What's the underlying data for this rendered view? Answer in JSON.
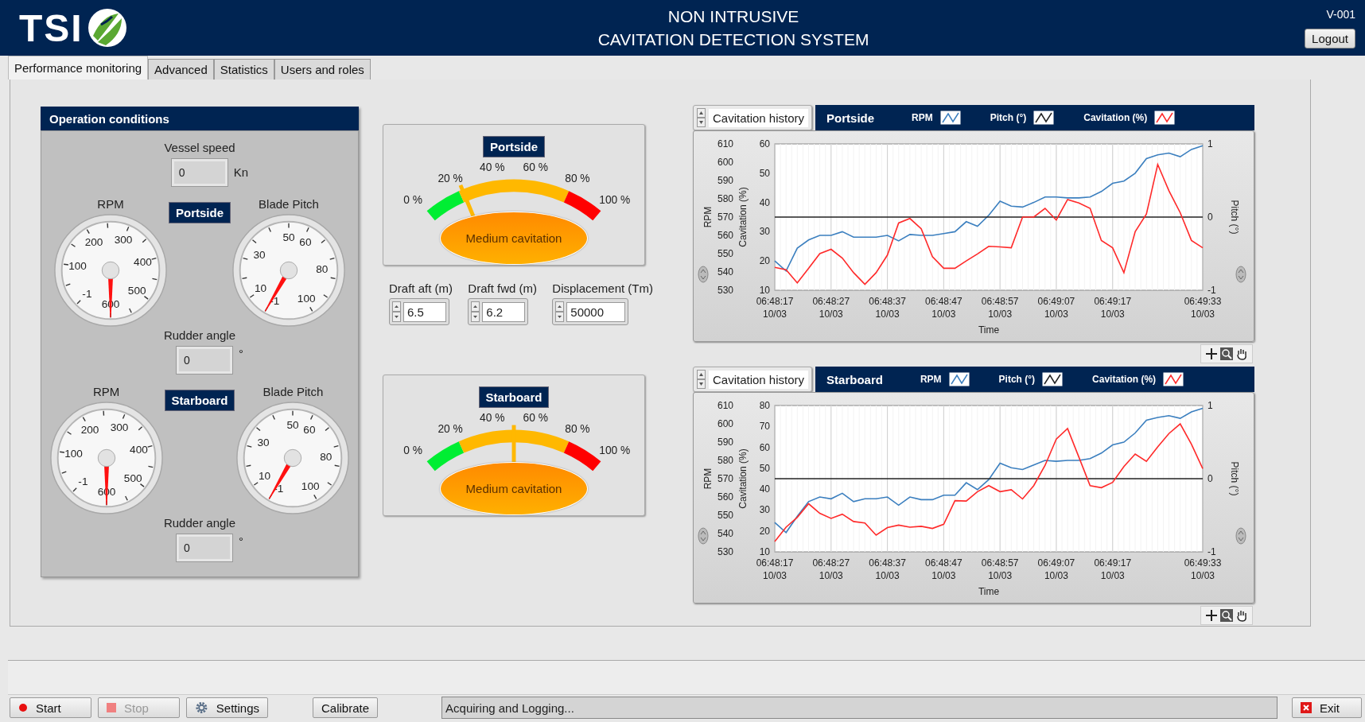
{
  "header": {
    "logo_text": "TSI",
    "title_lines": [
      "NON INTRUSIVE",
      "CAVITATION DETECTION SYSTEM"
    ],
    "version": "V-001",
    "logout": "Logout"
  },
  "tabs": [
    {
      "label": "Performance monitoring",
      "selected": true
    },
    {
      "label": "Advanced",
      "selected": false
    },
    {
      "label": "Statistics",
      "selected": false
    },
    {
      "label": "Users and roles",
      "selected": false
    }
  ],
  "operation_conditions": {
    "title": "Operation conditions",
    "vessel_speed": {
      "label": "Vessel speed",
      "value": "0",
      "unit": "Kn"
    },
    "sides": [
      {
        "tag": "Portside",
        "dials": [
          {
            "kind": "rpm",
            "label": "RPM",
            "scale": [
              "-1",
              "100",
              "200",
              "300",
              "400",
              "500",
              "600"
            ]
          },
          {
            "kind": "pitch",
            "label": "Blade Pitch",
            "scale": [
              "-1",
              "10",
              "30",
              "50",
              "60",
              "80",
              "100"
            ]
          }
        ],
        "rudder": {
          "label": "Rudder angle",
          "value": "0",
          "unit": "°"
        }
      },
      {
        "tag": "Starboard",
        "dials": [
          {
            "kind": "rpm",
            "label": "RPM",
            "scale": [
              "-1",
              "100",
              "200",
              "300",
              "400",
              "500",
              "600"
            ]
          },
          {
            "kind": "pitch",
            "label": "Blade Pitch",
            "scale": [
              "-1",
              "10",
              "30",
              "50",
              "60",
              "80",
              "100"
            ]
          }
        ],
        "rudder": {
          "label": "Rudder angle",
          "value": "0",
          "unit": "°"
        }
      }
    ]
  },
  "meters": [
    {
      "tag": "Portside",
      "scale": [
        "0 %",
        "20 %",
        "40 %",
        "60 %",
        "80 %",
        "100 %"
      ],
      "status": "Medium cavitation"
    },
    {
      "tag": "Starboard",
      "scale": [
        "0 %",
        "20 %",
        "40 %",
        "60 %",
        "80 %",
        "100 %"
      ],
      "status": "Medium cavitation"
    }
  ],
  "draft_fields": [
    {
      "label": "Draft aft (m)",
      "value": "6.5"
    },
    {
      "label": "Draft fwd (m)",
      "value": "6.2"
    },
    {
      "label": "Displacement (Tm)",
      "value": "50000"
    }
  ],
  "charts": [
    {
      "selector": "Cavitation history",
      "layers": [
        {
          "chart_data": {
            "type": "line",
            "title": "Portside",
            "grid": true,
            "xlabel": "Time",
            "ylabel": "RPM",
            "ylim": [
              530,
              610
            ],
            "yticks": [
              530,
              540,
              550,
              560,
              570,
              580,
              590,
              600,
              610
            ],
            "categories": [
              "06:48:17\n10/03",
              null,
              null,
              null,
              null,
              "06:48:27\n10/03",
              null,
              null,
              null,
              null,
              "06:48:37\n10/03",
              null,
              null,
              null,
              null,
              "06:48:47\n10/03",
              null,
              null,
              null,
              null,
              "06:48:57\n10/03",
              null,
              null,
              null,
              null,
              "06:49:07\n10/03",
              null,
              null,
              null,
              null,
              "06:49:17\n10/03",
              null,
              null,
              null,
              null,
              null,
              null,
              null,
              "06:49:33\n10/03"
            ],
            "series": [
              {
                "name": "RPM",
                "color": "#3b7fbf",
                "values": [
                  546,
                  540.5,
                  553,
                  557.5,
                  560,
                  560,
                  562,
                  559,
                  559,
                  559,
                  560,
                  557,
                  560.5,
                  560,
                  560,
                  561,
                  562,
                  567.5,
                  565,
                  571,
                  578.7,
                  576,
                  575.5,
                  578,
                  581,
                  581,
                  580.5,
                  580.5,
                  581,
                  584,
                  588.5,
                  589.7,
                  594,
                  602,
                  604,
                  605,
                  603,
                  607,
                  609
                ]
              }
            ]
          }
        },
        {
          "chart_data": {
            "type": "line",
            "ylabel": "Pitch (°)",
            "ylim": [
              -1,
              1
            ],
            "yticks": [
              -1,
              0,
              1
            ],
            "series": [
              {
                "name": "Pitch (°)",
                "color": "#222222",
                "values": [
                  0,
                  0,
                  0,
                  0,
                  0,
                  0,
                  0,
                  0,
                  0,
                  0,
                  0,
                  0,
                  0,
                  0,
                  0,
                  0,
                  0,
                  0,
                  0,
                  0,
                  0,
                  0,
                  0,
                  0,
                  0,
                  0,
                  0,
                  0,
                  0,
                  0,
                  0,
                  0,
                  0,
                  0,
                  0,
                  0,
                  0,
                  0,
                  0
                ]
              }
            ]
          }
        },
        {
          "chart_data": {
            "type": "line",
            "ylabel": "Cavitation (%)",
            "ylim": [
              10,
              60
            ],
            "yticks": [
              10,
              20,
              30,
              40,
              50,
              60
            ],
            "series": [
              {
                "name": "Cavitation (%)",
                "color": "#ff2a2a",
                "values": [
                  17.8,
                  17,
                  12.5,
                  17.5,
                  22.5,
                  24,
                  21,
                  16,
                  12,
                  16,
                  22,
                  33,
                  34.5,
                  31,
                  21.5,
                  17.5,
                  17.5,
                  20,
                  22.4,
                  25,
                  24.8,
                  24.5,
                  35,
                  35,
                  38,
                  34,
                  41,
                  39.8,
                  38,
                  27,
                  24.5,
                  16,
                  30,
                  36,
                  53,
                  44,
                  36.5,
                  27,
                  24.5
                ]
              }
            ]
          }
        }
      ]
    },
    {
      "selector": "Cavitation history",
      "layers": [
        {
          "chart_data": {
            "type": "line",
            "title": "Starboard",
            "grid": true,
            "xlabel": "Time",
            "ylabel": "RPM",
            "ylim": [
              530,
              610
            ],
            "yticks": [
              530,
              540,
              550,
              560,
              570,
              580,
              590,
              600,
              610
            ],
            "categories": [
              "06:48:17\n10/03",
              null,
              null,
              null,
              null,
              "06:48:27\n10/03",
              null,
              null,
              null,
              null,
              "06:48:37\n10/03",
              null,
              null,
              null,
              null,
              "06:48:47\n10/03",
              null,
              null,
              null,
              null,
              "06:48:57\n10/03",
              null,
              null,
              null,
              null,
              "06:49:07\n10/03",
              null,
              null,
              null,
              null,
              "06:49:17\n10/03",
              null,
              null,
              null,
              null,
              null,
              null,
              null,
              "06:49:33\n10/03"
            ],
            "series": [
              {
                "name": "RPM",
                "color": "#3b7fbf",
                "values": [
                  546,
                  540.5,
                  549.5,
                  557.5,
                  560,
                  559,
                  562,
                  557.5,
                  559,
                  559,
                  560,
                  555.5,
                  560,
                  558.5,
                  558.5,
                  561,
                  561,
                  567.8,
                  564,
                  569.5,
                  578.5,
                  576,
                  575,
                  577.5,
                  580,
                  579.5,
                  580,
                  580,
                  581,
                  584,
                  588.5,
                  590,
                  595,
                  602,
                  603.5,
                  604.5,
                  603,
                  606.5,
                  608.5
                ]
              }
            ]
          }
        },
        {
          "chart_data": {
            "type": "line",
            "ylabel": "Pitch (°)",
            "ylim": [
              -1,
              1
            ],
            "yticks": [
              -1,
              0,
              1
            ],
            "series": [
              {
                "name": "Pitch (°)",
                "color": "#222222",
                "values": [
                  0,
                  0,
                  0,
                  0,
                  0,
                  0,
                  0,
                  0,
                  0,
                  0,
                  0,
                  0,
                  0,
                  0,
                  0,
                  0,
                  0,
                  0,
                  0,
                  0,
                  0,
                  0,
                  0,
                  0,
                  0,
                  0,
                  0,
                  0,
                  0,
                  0,
                  0,
                  0,
                  0,
                  0,
                  0,
                  0,
                  0,
                  0,
                  0
                ]
              }
            ]
          }
        },
        {
          "chart_data": {
            "type": "line",
            "ylabel": "Cavitation (%)",
            "ylim": [
              10,
              80
            ],
            "yticks": [
              10,
              20,
              30,
              40,
              50,
              60,
              70,
              80
            ],
            "series": [
              {
                "name": "Cavitation (%)",
                "color": "#ff2a2a",
                "values": [
                  15,
                  21.8,
                  26.5,
                  33,
                  28.4,
                  26,
                  28,
                  24.5,
                  23.8,
                  18,
                  21.6,
                  22.8,
                  21.8,
                  22.2,
                  21.2,
                  23.2,
                  34.5,
                  34.3,
                  38.8,
                  41.7,
                  38.8,
                  39.7,
                  35.3,
                  41.7,
                  51.4,
                  64,
                  69,
                  55.3,
                  41.7,
                  40.7,
                  43.2,
                  50.8,
                  56.8,
                  53.3,
                  60.2,
                  66.6,
                  71.2,
                  61.5,
                  49.8
                ]
              }
            ]
          }
        }
      ]
    }
  ],
  "toolbar": [
    {
      "kind": "start",
      "label": "Start",
      "disabled": false
    },
    {
      "kind": "stop",
      "label": "Stop",
      "disabled": true
    },
    {
      "kind": "settings",
      "label": "Settings",
      "disabled": false
    },
    {
      "kind": "calibrate",
      "label": "Calibrate",
      "disabled": false
    }
  ],
  "status": "Acquiring and Logging...",
  "exit": "Exit"
}
